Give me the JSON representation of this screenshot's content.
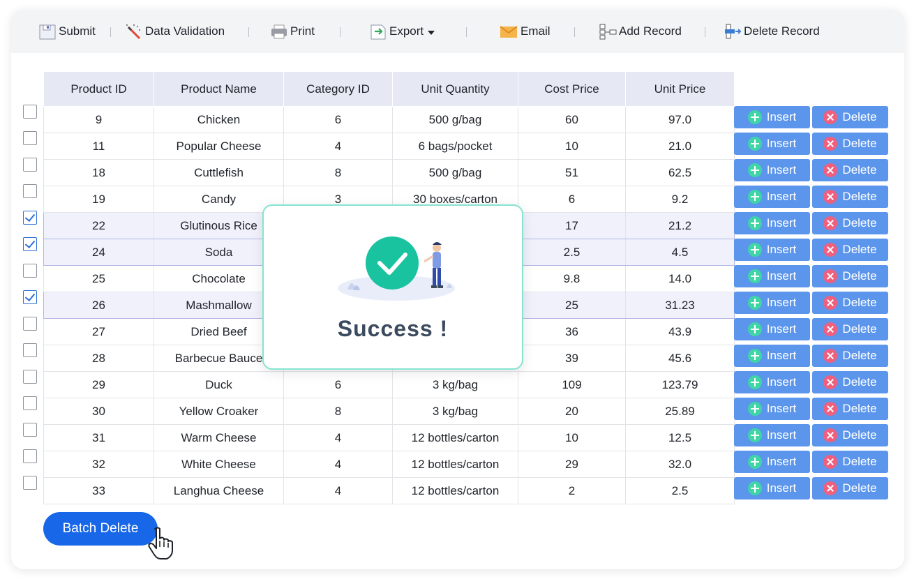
{
  "toolbar": {
    "submit": "Submit",
    "data_validation": "Data Validation",
    "print": "Print",
    "export": "Export",
    "email": "Email",
    "add_record": "Add Record",
    "delete_record": "Delete Record"
  },
  "table": {
    "headers": [
      "Product ID",
      "Product Name",
      "Category ID",
      "Unit Quantity",
      "Cost Price",
      "Unit Price"
    ],
    "rows": [
      {
        "id": "9",
        "name": "Chicken",
        "cat": "6",
        "qty": "500 g/bag",
        "cost": "60",
        "price": "97.0",
        "checked": false
      },
      {
        "id": "11",
        "name": "Popular Cheese",
        "cat": "4",
        "qty": "6 bags/pocket",
        "cost": "10",
        "price": "21.0",
        "checked": false
      },
      {
        "id": "18",
        "name": "Cuttlefish",
        "cat": "8",
        "qty": "500 g/bag",
        "cost": "51",
        "price": "62.5",
        "checked": false
      },
      {
        "id": "19",
        "name": "Candy",
        "cat": "3",
        "qty": "30 boxes/carton",
        "cost": "6",
        "price": "9.2",
        "checked": false
      },
      {
        "id": "22",
        "name": "Glutinous Rice",
        "cat": "",
        "qty": "",
        "cost": "17",
        "price": "21.2",
        "checked": true
      },
      {
        "id": "24",
        "name": "Soda",
        "cat": "",
        "qty": "",
        "cost": "2.5",
        "price": "4.5",
        "checked": true
      },
      {
        "id": "25",
        "name": "Chocolate",
        "cat": "",
        "qty": "",
        "cost": "9.8",
        "price": "14.0",
        "checked": false
      },
      {
        "id": "26",
        "name": "Mashmallow",
        "cat": "",
        "qty": "",
        "cost": "25",
        "price": "31.23",
        "checked": true
      },
      {
        "id": "27",
        "name": "Dried Beef",
        "cat": "",
        "qty": "",
        "cost": "36",
        "price": "43.9",
        "checked": false
      },
      {
        "id": "28",
        "name": "Barbecue Bauce",
        "cat": "",
        "qty": "",
        "cost": "39",
        "price": "45.6",
        "checked": false
      },
      {
        "id": "29",
        "name": "Duck",
        "cat": "6",
        "qty": "3 kg/bag",
        "cost": "109",
        "price": "123.79",
        "checked": false
      },
      {
        "id": "30",
        "name": "Yellow Croaker",
        "cat": "8",
        "qty": "3 kg/bag",
        "cost": "20",
        "price": "25.89",
        "checked": false
      },
      {
        "id": "31",
        "name": "Warm Cheese",
        "cat": "4",
        "qty": "12 bottles/carton",
        "cost": "10",
        "price": "12.5",
        "checked": false
      },
      {
        "id": "32",
        "name": "White Cheese",
        "cat": "4",
        "qty": "12 bottles/carton",
        "cost": "29",
        "price": "32.0",
        "checked": false
      },
      {
        "id": "33",
        "name": "Langhua Cheese",
        "cat": "4",
        "qty": "12 bottles/carton",
        "cost": "2",
        "price": "2.5",
        "checked": false
      }
    ]
  },
  "row_actions": {
    "insert": "Insert",
    "delete": "Delete"
  },
  "batch_delete": "Batch Delete",
  "modal": {
    "title": "Success !"
  },
  "colors": {
    "accent": "#1767e8",
    "row_button": "#5b95ec",
    "insert_icon": "#3fd5a6",
    "delete_icon": "#f0607e",
    "success": "#19c3a0"
  }
}
